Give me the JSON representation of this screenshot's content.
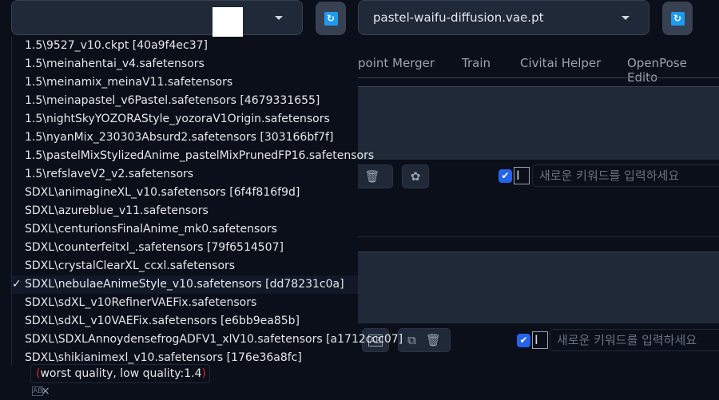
{
  "checkpoint": {
    "value": "",
    "refresh_icon": "refresh-icon"
  },
  "vae": {
    "value": "pastel-waifu-diffusion.vae.pt"
  },
  "tabs": [
    "point Merger",
    "Train",
    "Civitai Helper",
    "OpenPose Edito"
  ],
  "checkpoint_options": [
    "1.5\\9527_v10.ckpt [40a9f4ec37]",
    "1.5\\meinahentai_v4.safetensors",
    "1.5\\meinamix_meinaV11.safetensors",
    "1.5\\meinapastel_v6Pastel.safetensors [4679331655]",
    "1.5\\nightSkyYOZORAStyle_yozoraV1Origin.safetensors",
    "1.5\\nyanMix_230303Absurd2.safetensors [303166bf7f]",
    "1.5\\pastelMixStylizedAnime_pastelMixPrunedFP16.safetensors",
    "1.5\\refslaveV2_v2.safetensors",
    "SDXL\\animagineXL_v10.safetensors [6f4f816f9d]",
    "SDXL\\azureblue_v11.safetensors",
    "SDXL\\centurionsFinalAnime_mk0.safetensors",
    "SDXL\\counterfeitxl_.safetensors [79f6514507]",
    "SDXL\\crystalClearXL_ccxl.safetensors",
    "SDXL\\nebulaeAnimeStyle_v10.safetensors [dd78231c0a]",
    "SDXL\\sdXL_v10RefinerVAEFix.safetensors",
    "SDXL\\sdXL_v10VAEFix.safetensors [e6bb9ea85b]",
    "SDXL\\SDXLAnnoydensefrogADFV1_xlV10.safetensors [a1712ccc07]",
    "SDXL\\shikianimexl_v10.safetensors [176e36a8fc]"
  ],
  "selected_index": 13,
  "check_mark": "✓",
  "negative_tag": {
    "open": "(",
    "text": "worst quality, low quality:1.4",
    "close": ")",
    "remove": "×"
  },
  "keyword_placeholder": "새로운 키워드를 입력하세요",
  "colors": {
    "background": "#0b0f19",
    "panel": "#1f2937",
    "accent": "#2563eb",
    "refresh": "#1d9bf0",
    "paren": "#dc2626"
  }
}
